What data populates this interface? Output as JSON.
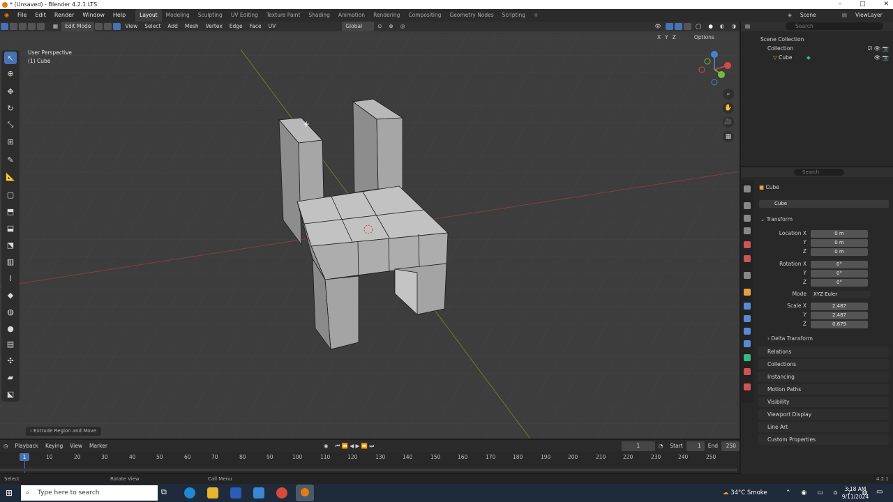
{
  "window": {
    "title": "* (Unsaved) - Blender 4.2.1 LTS"
  },
  "menu": [
    "File",
    "Edit",
    "Render",
    "Window",
    "Help"
  ],
  "workspaces": [
    "Layout",
    "Modeling",
    "Sculpting",
    "UV Editing",
    "Texture Paint",
    "Shading",
    "Animation",
    "Rendering",
    "Compositing",
    "Geometry Nodes",
    "Scripting"
  ],
  "active_workspace": "Layout",
  "scene": {
    "name": "Scene",
    "view_layer": "ViewLayer"
  },
  "viewport": {
    "mode": "Edit Mode",
    "menus": [
      "View",
      "Select",
      "Add",
      "Mesh",
      "Vertex",
      "Edge",
      "Face",
      "UV"
    ],
    "orientation": "Global",
    "options_label": "Options",
    "axes": [
      "X",
      "Y",
      "Z"
    ],
    "perspective_label": "User Perspective",
    "object_label": "(1) Cube",
    "last_op": "Extrude Region and Move"
  },
  "outliner": {
    "search_placeholder": "Search",
    "items": [
      "Scene Collection",
      "Collection",
      "Cube"
    ]
  },
  "properties": {
    "search_placeholder": "Search",
    "object_name": "Cube",
    "data_name": "Cube",
    "transform_label": "Transform",
    "location": {
      "label": "Location X",
      "x": "0 m",
      "y": "0 m",
      "z": "0 m"
    },
    "rotation": {
      "label": "Rotation X",
      "x": "0°",
      "y": "0°",
      "z": "0°"
    },
    "mode_label": "Mode",
    "mode_value": "XYZ Euler",
    "scale": {
      "label": "Scale X",
      "x": "2.487",
      "y": "2.487",
      "z": "0.679"
    },
    "y_label": "Y",
    "z_label": "Z",
    "delta_transform": "Delta Transform",
    "sections": [
      "Relations",
      "Collections",
      "Instancing",
      "Motion Paths",
      "Visibility",
      "Viewport Display",
      "Line Art",
      "Custom Properties"
    ]
  },
  "timeline": {
    "menus": [
      "Playback",
      "Keying",
      "View",
      "Marker"
    ],
    "current_frame": "1",
    "start_label": "Start",
    "start": "1",
    "end_label": "End",
    "end": "250",
    "ticks": [
      "1",
      "10",
      "20",
      "30",
      "40",
      "50",
      "60",
      "70",
      "80",
      "90",
      "100",
      "110",
      "120",
      "130",
      "140",
      "150",
      "160",
      "170",
      "180",
      "190",
      "200",
      "210",
      "220",
      "230",
      "240",
      "250"
    ]
  },
  "statusbar": {
    "select": "Select",
    "rotate": "Rotate View",
    "call_menu": "Call Menu",
    "version": "4.2.1"
  },
  "taskbar": {
    "search_placeholder": "Type here to search",
    "weather": "34°C  Smoke",
    "time": "3:18 AM",
    "date": "9/11/2024"
  }
}
